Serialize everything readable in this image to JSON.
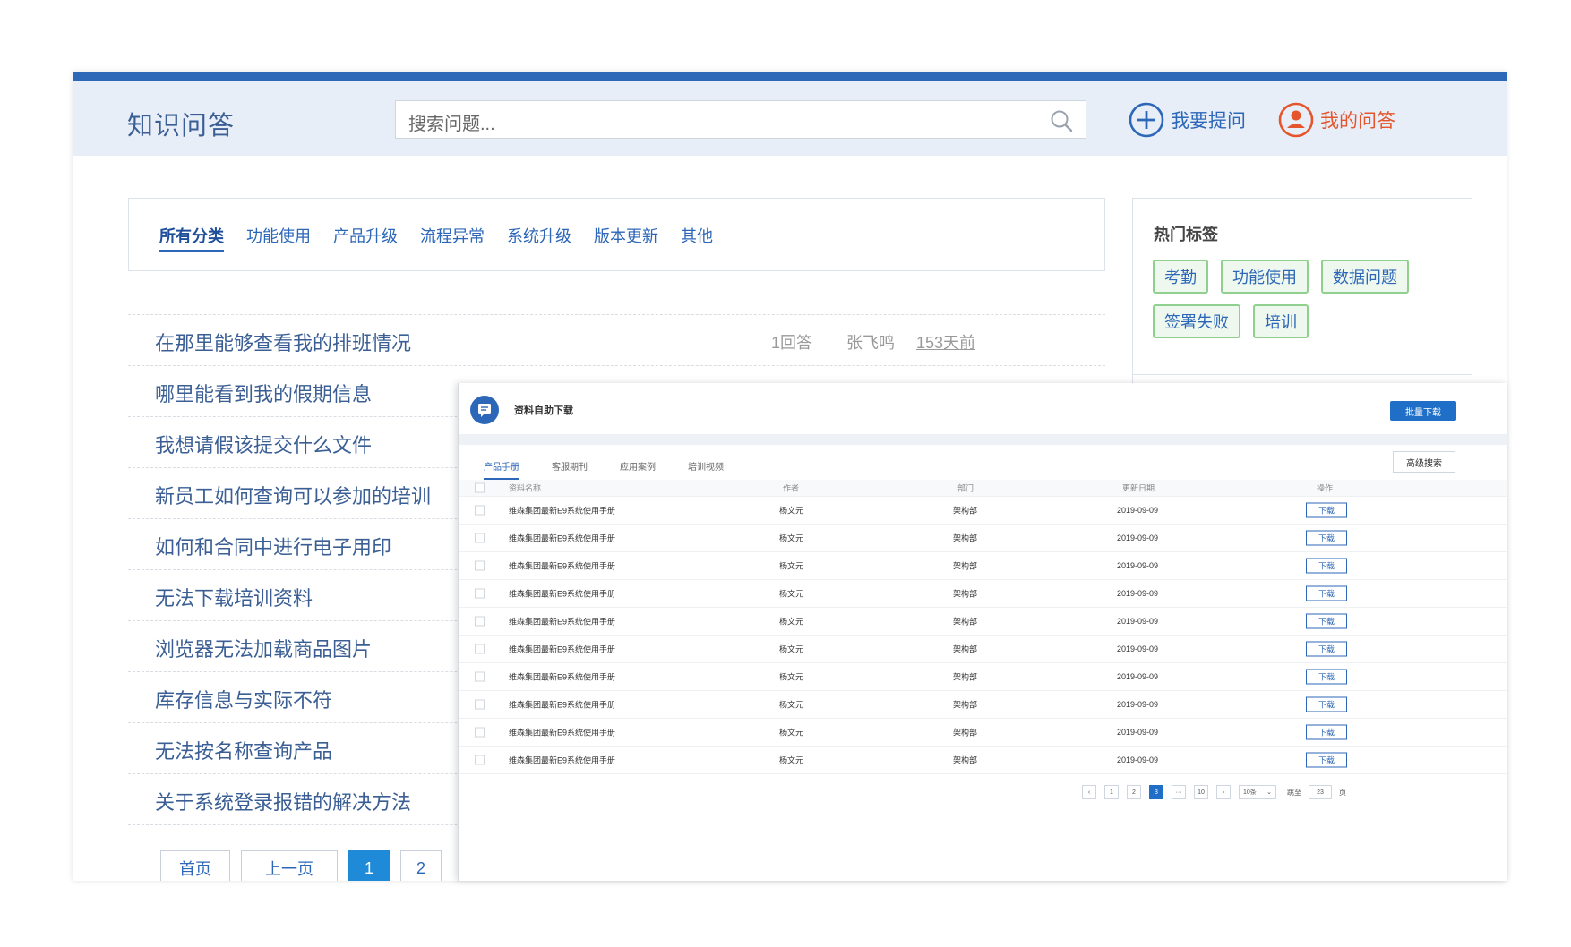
{
  "header": {
    "logo": "知识问答",
    "search_placeholder": "搜索问题...",
    "ask_label": "我要提问",
    "mine_label": "我的问答"
  },
  "categories": [
    "所有分类",
    "功能使用",
    "产品升级",
    "流程异常",
    "系统升级",
    "版本更新",
    "其他"
  ],
  "questions": [
    {
      "title": "在那里能够查看我的排班情况",
      "answers": "1回答",
      "author": "张飞鸣",
      "time": "153天前"
    },
    {
      "title": "哪里能看到我的假期信息"
    },
    {
      "title": "我想请假该提交什么文件"
    },
    {
      "title": "新员工如何查询可以参加的培训"
    },
    {
      "title": "如何和合同中进行电子用印"
    },
    {
      "title": "无法下载培训资料"
    },
    {
      "title": "浏览器无法加载商品图片"
    },
    {
      "title": "库存信息与实际不符"
    },
    {
      "title": "无法按名称查询产品"
    },
    {
      "title": "关于系统登录报错的解决方法"
    }
  ],
  "pager": {
    "first": "首页",
    "prev": "上一页",
    "pages": [
      "1",
      "2"
    ]
  },
  "hot_tags": {
    "title": "热门标签",
    "items": [
      "考勤",
      "功能使用",
      "数据问题",
      "签署失败",
      "培训"
    ]
  },
  "download": {
    "title": "资料自助下载",
    "batch_label": "批量下载",
    "tabs": [
      "产品手册",
      "客服期刊",
      "应用案例",
      "培训视频"
    ],
    "advanced_label": "高级搜索",
    "columns": [
      "资料名称",
      "作者",
      "部门",
      "更新日期",
      "操作"
    ],
    "rows": [
      {
        "name": "维森集团最新E9系统使用手册",
        "author": "杨文元",
        "dept": "架构部",
        "date": "2019-09-09",
        "action": "下载"
      },
      {
        "name": "维森集团最新E9系统使用手册",
        "author": "杨文元",
        "dept": "架构部",
        "date": "2019-09-09",
        "action": "下载"
      },
      {
        "name": "维森集团最新E9系统使用手册",
        "author": "杨文元",
        "dept": "架构部",
        "date": "2019-09-09",
        "action": "下载"
      },
      {
        "name": "维森集团最新E9系统使用手册",
        "author": "杨文元",
        "dept": "架构部",
        "date": "2019-09-09",
        "action": "下载"
      },
      {
        "name": "维森集团最新E9系统使用手册",
        "author": "杨文元",
        "dept": "架构部",
        "date": "2019-09-09",
        "action": "下载"
      },
      {
        "name": "维森集团最新E9系统使用手册",
        "author": "杨文元",
        "dept": "架构部",
        "date": "2019-09-09",
        "action": "下载"
      },
      {
        "name": "维森集团最新E9系统使用手册",
        "author": "杨文元",
        "dept": "架构部",
        "date": "2019-09-09",
        "action": "下载"
      },
      {
        "name": "维森集团最新E9系统使用手册",
        "author": "杨文元",
        "dept": "架构部",
        "date": "2019-09-09",
        "action": "下载"
      },
      {
        "name": "维森集团最新E9系统使用手册",
        "author": "杨文元",
        "dept": "架构部",
        "date": "2019-09-09",
        "action": "下载"
      },
      {
        "name": "维森集团最新E9系统使用手册",
        "author": "杨文元",
        "dept": "架构部",
        "date": "2019-09-09",
        "action": "下载"
      }
    ],
    "pager": {
      "pages": [
        "1",
        "2",
        "3",
        "···",
        "10"
      ],
      "size": "10条",
      "jump_label": "跳至",
      "jump_value": "23",
      "page_unit": "页"
    }
  },
  "colors": {
    "brand": "#2d67b8",
    "accent_orange": "#e5552d",
    "tag_border": "#8fd08f"
  }
}
